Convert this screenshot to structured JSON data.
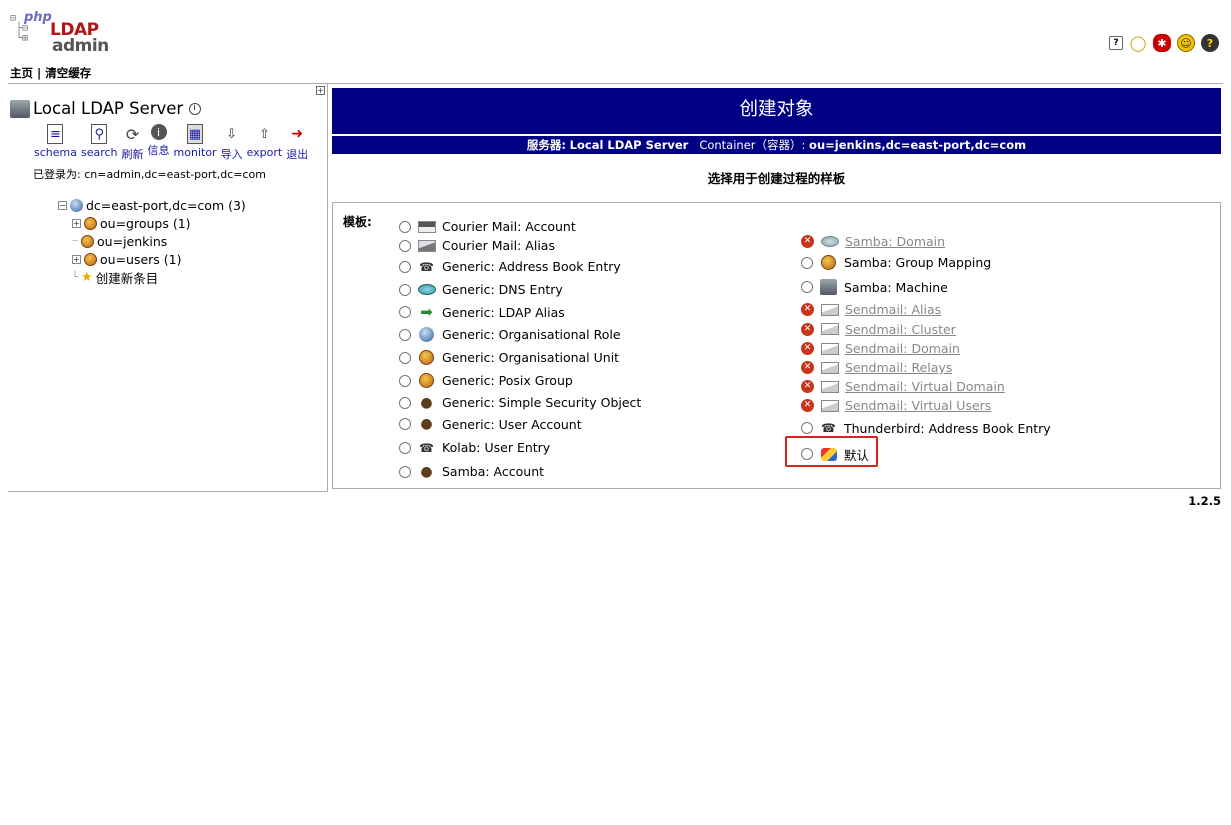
{
  "logo": {
    "php": "php",
    "ldap": "LDAP",
    "admin": "admin"
  },
  "top_icons": [
    "help-icon",
    "lightbulb-icon",
    "bug-icon",
    "smiley-icon",
    "question-icon"
  ],
  "nav": {
    "home": "主页",
    "clear_cache": "清空缓存"
  },
  "sidebar": {
    "server_name": "Local LDAP Server",
    "tools": [
      {
        "label": "schema",
        "icon": "schema-icon"
      },
      {
        "label": "search",
        "icon": "search-icon"
      },
      {
        "label": "刷新",
        "icon": "refresh-icon"
      },
      {
        "label": "信息",
        "icon": "info-icon"
      },
      {
        "label": "monitor",
        "icon": "monitor-icon"
      },
      {
        "label": "导入",
        "icon": "import-icon"
      },
      {
        "label": "export",
        "icon": "export-icon"
      },
      {
        "label": "退出",
        "icon": "logout-icon"
      }
    ],
    "logged_in_as": "已登录为: cn=admin,dc=east-port,dc=com",
    "tree": {
      "root": "dc=east-port,dc=com (3)",
      "children": [
        "ou=groups (1)",
        "ou=jenkins",
        "ou=users (1)",
        "创建新条目"
      ]
    }
  },
  "main": {
    "title": "创建对象",
    "server_label": "服务器:",
    "server_value": "Local LDAP Server",
    "container_label": "Container（容器）:",
    "container_value": "ou=jenkins,dc=east-port,dc=com",
    "choose": "选择用于创建过程的样板",
    "template_label": "模板:",
    "templates_left": [
      "Courier Mail: Account",
      "Courier Mail: Alias",
      "Generic: Address Book Entry",
      "Generic: DNS Entry",
      "Generic: LDAP Alias",
      "Generic: Organisational Role",
      "Generic: Organisational Unit",
      "Generic: Posix Group",
      "Generic: Simple Security Object",
      "Generic: User Account",
      "Kolab: User Entry",
      "Samba: Account"
    ],
    "templates_right": [
      {
        "label": "Samba: Domain",
        "disabled": true
      },
      {
        "label": "Samba: Group Mapping",
        "disabled": false
      },
      {
        "label": "Samba: Machine",
        "disabled": false
      },
      {
        "label": "Sendmail: Alias",
        "disabled": true
      },
      {
        "label": "Sendmail: Cluster",
        "disabled": true
      },
      {
        "label": "Sendmail: Domain",
        "disabled": true
      },
      {
        "label": "Sendmail: Relays",
        "disabled": true
      },
      {
        "label": "Sendmail: Virtual Domain",
        "disabled": true
      },
      {
        "label": "Sendmail: Virtual Users",
        "disabled": true
      },
      {
        "label": "Thunderbird: Address Book Entry",
        "disabled": false
      },
      {
        "label": "默认",
        "disabled": false
      }
    ]
  },
  "version": "1.2.5",
  "colors": {
    "header_bg": "#000082",
    "highlight": "#e02020"
  }
}
